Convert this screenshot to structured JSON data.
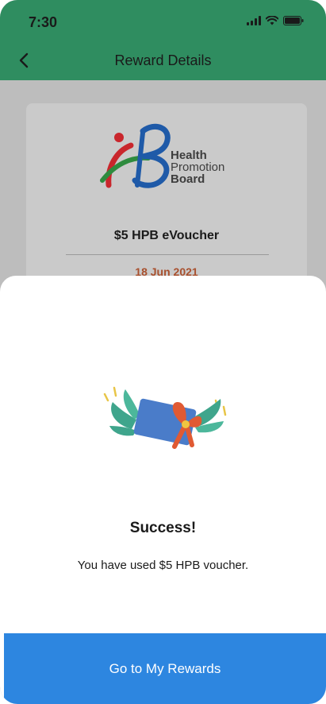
{
  "status_bar": {
    "time": "7:30"
  },
  "header": {
    "title": "Reward Details"
  },
  "reward_card": {
    "logo_lines": [
      "Health",
      "Promotion",
      "Board"
    ],
    "title": "$5 HPB eVoucher",
    "date": "18 Jun 2021"
  },
  "sheet": {
    "title": "Success!",
    "message": "You have used $5 HPB voucher."
  },
  "cta": {
    "label": "Go to My Rewards"
  },
  "colors": {
    "header_green": "#2f8d60",
    "cta_blue": "#2d86e0",
    "date_orange": "#a8502e"
  }
}
